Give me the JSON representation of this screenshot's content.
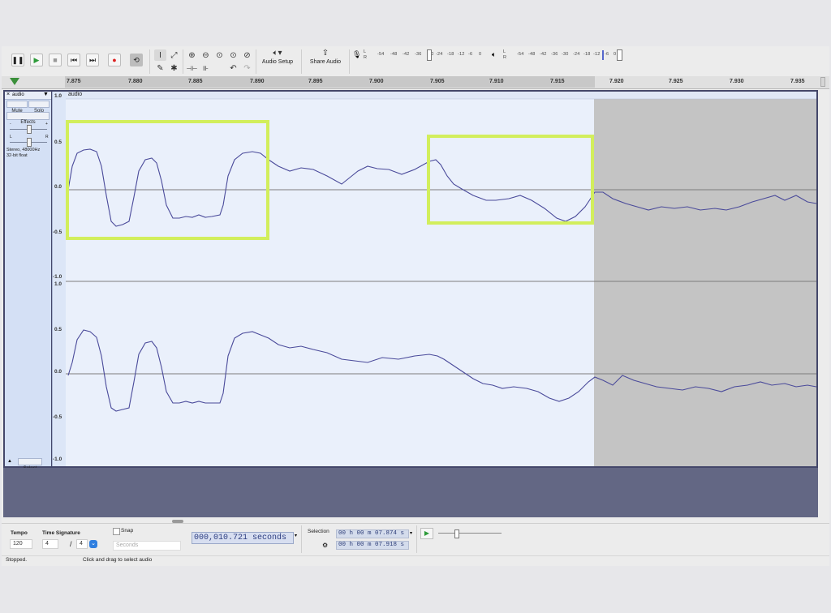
{
  "toolbar": {
    "transport_icons": [
      "pause-icon",
      "play-icon",
      "stop-icon",
      "skip-start-icon",
      "skip-end-icon",
      "record-icon",
      "loop-icon"
    ],
    "audio_setup_label": "Audio Setup",
    "share_audio_label": "Share Audio",
    "record_meter": {
      "channels": [
        "L",
        "R"
      ],
      "scale": [
        "-54",
        "-48",
        "-42",
        "-36",
        "-30",
        "-24",
        "-18",
        "-12",
        "-6",
        "0"
      ]
    },
    "playback_meter": {
      "channels": [
        "L",
        "R"
      ],
      "scale": [
        "-54",
        "-48",
        "-42",
        "-36",
        "-30",
        "-24",
        "-18",
        "-12",
        "-6",
        "0"
      ]
    }
  },
  "ruler": {
    "ticks": [
      "7.875",
      "7.880",
      "7.885",
      "7.890",
      "7.895",
      "7.900",
      "7.905",
      "7.910",
      "7.915",
      "7.920",
      "7.925",
      "7.930",
      "7.935"
    ]
  },
  "track": {
    "name": "audio",
    "clip_name": "audio",
    "mute_label": "Mute",
    "solo_label": "Solo",
    "effects_label": "Effects",
    "gain_left": "-",
    "gain_right": "+",
    "pan_left": "L",
    "pan_right": "R",
    "info_line1": "Stereo, 48000Hz",
    "info_line2": "32-bit float",
    "select_label": "Select",
    "amplitude_labels": [
      "1.0",
      "0.5",
      "0.0",
      "-0.5",
      "-1.0"
    ]
  },
  "bottom": {
    "tempo_label": "Tempo",
    "tempo_value": "120",
    "time_signature_label": "Time Signature",
    "time_sig_top": "4",
    "time_sig_slash": "/",
    "time_sig_bottom": "4",
    "snap_label": "Snap",
    "snap_unit": "Seconds",
    "time_display": "000,010.721 seconds",
    "selection_label": "Selection",
    "selection_start": "00 h 00 m 07.874 s",
    "selection_end": "00 h 00 m 07.918 s"
  },
  "status": {
    "state": "Stopped.",
    "hint": "Click and drag to select audio"
  },
  "colors": {
    "selection_bg": "#eaf0fb",
    "unselected_bg": "#c4c4c4",
    "waveform": "#4a4a9a",
    "highlight_box": "#d2ee5c",
    "empty_area": "#636784"
  }
}
